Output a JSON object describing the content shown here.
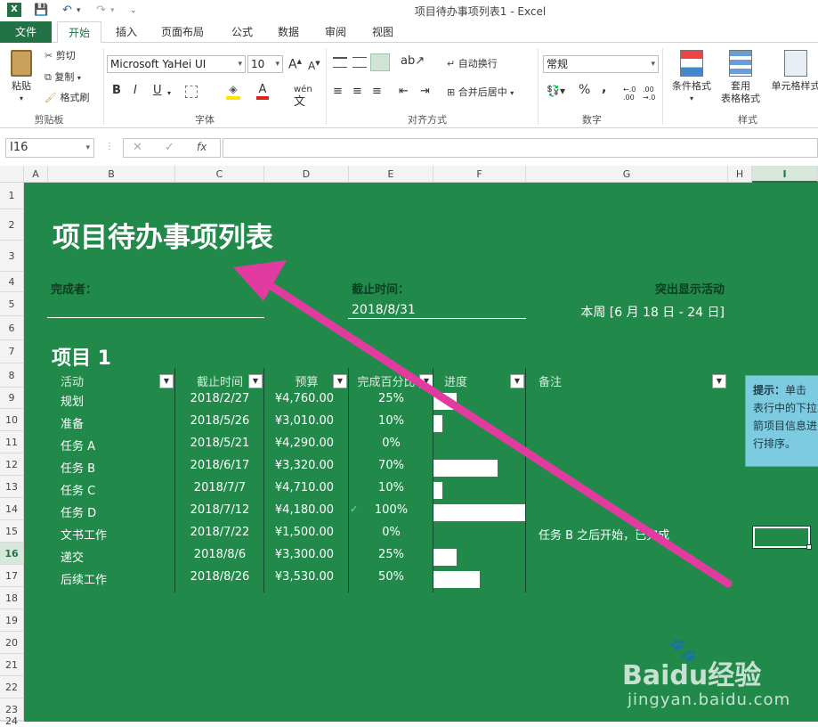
{
  "window": {
    "title": "项目待办事项列表1 - Excel"
  },
  "tabs": [
    "文件",
    "开始",
    "插入",
    "页面布局",
    "公式",
    "数据",
    "审阅",
    "视图"
  ],
  "ribbon": {
    "clipboard": {
      "paste": "粘贴",
      "cut": "剪切",
      "copy": "复制",
      "format_painter": "格式刷",
      "label": "剪贴板"
    },
    "font": {
      "name": "Microsoft YaHei UI",
      "size": "10",
      "label": "字体",
      "bold": "B",
      "italic": "I",
      "underline": "U"
    },
    "alignment": {
      "wrap": "自动换行",
      "merge": "合并后居中",
      "label": "对齐方式"
    },
    "number": {
      "format": "常规",
      "label": "数字",
      "percent": "%",
      "comma": ","
    },
    "styles": {
      "conditional": "条件格式",
      "table_line1": "套用",
      "table_line2": "表格格式",
      "cell_styles": "单元格样式",
      "label": "样式"
    }
  },
  "formula_bar": {
    "name_box": "I16",
    "fx": "fx",
    "value": ""
  },
  "columns": [
    "A",
    "B",
    "C",
    "D",
    "E",
    "F",
    "G",
    "H",
    "I"
  ],
  "rows": [
    "1",
    "2",
    "3",
    "4",
    "5",
    "6",
    "7",
    "8",
    "9",
    "10",
    "11",
    "12",
    "13",
    "14",
    "15",
    "16",
    "17",
    "18",
    "19",
    "20",
    "21",
    "22",
    "23",
    "24"
  ],
  "sheet": {
    "title": "项目待办事项列表",
    "completed_by_label": "完成者：",
    "deadline_label": "截止时间：",
    "deadline_value": "2018/8/31",
    "highlight_label": "突出显示活动",
    "highlight_value": "本周 [6 月 18 日 - 24 日]",
    "project_title": "项目 1",
    "headers": [
      "活动",
      "截止时间",
      "预算",
      "完成百分比",
      "进度",
      "备注"
    ],
    "rows": [
      {
        "activity": "规划",
        "due": "2018/2/27",
        "budget": "¥4,760.00",
        "pct": "25%",
        "progress": 0.25,
        "note": "",
        "check": ""
      },
      {
        "activity": "准备",
        "due": "2018/5/26",
        "budget": "¥3,010.00",
        "pct": "10%",
        "progress": 0.1,
        "note": "",
        "check": ""
      },
      {
        "activity": "任务 A",
        "due": "2018/5/21",
        "budget": "¥4,290.00",
        "pct": "0%",
        "progress": 0,
        "note": "",
        "check": ""
      },
      {
        "activity": "任务 B",
        "due": "2018/6/17",
        "budget": "¥3,320.00",
        "pct": "70%",
        "progress": 0.7,
        "note": "",
        "check": ""
      },
      {
        "activity": "任务 C",
        "due": "2018/7/7",
        "budget": "¥4,710.00",
        "pct": "10%",
        "progress": 0.1,
        "note": "",
        "check": ""
      },
      {
        "activity": "任务 D",
        "due": "2018/7/12",
        "budget": "¥4,180.00",
        "pct": "100%",
        "progress": 1.0,
        "note": "",
        "check": "✓"
      },
      {
        "activity": "文书工作",
        "due": "2018/7/22",
        "budget": "¥1,500.00",
        "pct": "0%",
        "progress": 0,
        "note": "任务 B 之后开始，已完成",
        "check": ""
      },
      {
        "activity": "递交",
        "due": "2018/8/6",
        "budget": "¥3,300.00",
        "pct": "25%",
        "progress": 0.25,
        "note": "",
        "check": ""
      },
      {
        "activity": "后续工作",
        "due": "2018/8/26",
        "budget": "¥3,530.00",
        "pct": "50%",
        "progress": 0.5,
        "note": "",
        "check": ""
      }
    ],
    "tip_bold": "提示：",
    "tip_text": "单击表行中的下拉箭项目信息进行排序。"
  },
  "watermark": {
    "brand": "Baidu经验",
    "url": "jingyan.baidu.com"
  },
  "colors": {
    "excel_green": "#217346",
    "sheet_bg": "#218a4a",
    "arrow": "#e23ba0",
    "tip_bg": "#7ccbe0"
  }
}
